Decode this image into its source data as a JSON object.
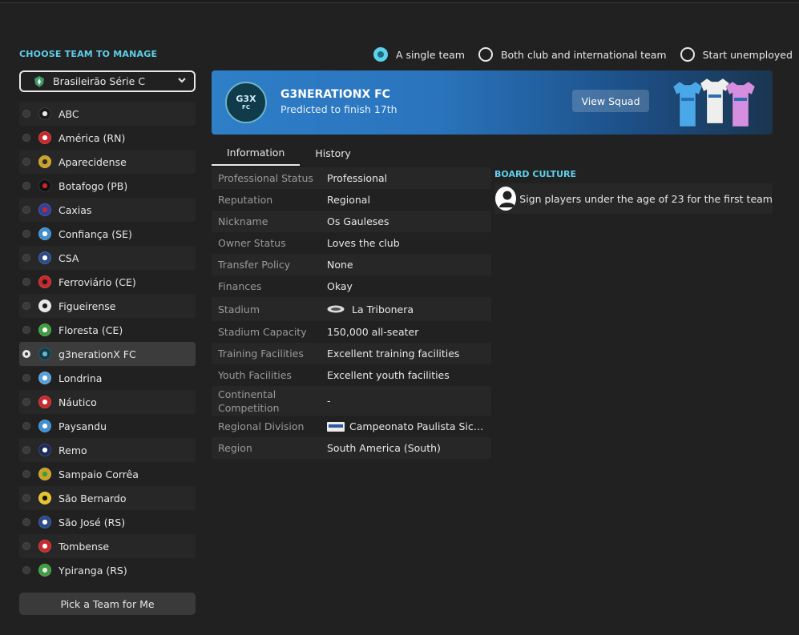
{
  "left": {
    "title": "CHOOSE TEAM TO MANAGE",
    "league": "Brasileirão Série C",
    "teams": [
      {
        "name": "ABC",
        "color": "#1b1b1b",
        "accent": "#e8e8e8"
      },
      {
        "name": "América (RN)",
        "color": "#c8282b",
        "accent": "#ffffff"
      },
      {
        "name": "Aparecidense",
        "color": "#c9a227",
        "accent": "#2b2b2b"
      },
      {
        "name": "Botafogo (PB)",
        "color": "#111111",
        "accent": "#c8282b"
      },
      {
        "name": "Caxias",
        "color": "#2f3f9b",
        "accent": "#c8282b"
      },
      {
        "name": "Confiança (SE)",
        "color": "#3f8fd0",
        "accent": "#ffffff"
      },
      {
        "name": "CSA",
        "color": "#2a4a8a",
        "accent": "#ffffff"
      },
      {
        "name": "Ferroviário (CE)",
        "color": "#c8282b",
        "accent": "#1b1b1b"
      },
      {
        "name": "Figueirense",
        "color": "#e8e8e8",
        "accent": "#1b1b1b"
      },
      {
        "name": "Floresta (CE)",
        "color": "#3f9b3f",
        "accent": "#ffffff"
      },
      {
        "name": "g3nerationX FC",
        "color": "#0f3b4a",
        "accent": "#6fb4c6",
        "selected": true
      },
      {
        "name": "Londrina",
        "color": "#5aa0d8",
        "accent": "#ffffff"
      },
      {
        "name": "Náutico",
        "color": "#c8282b",
        "accent": "#ffffff"
      },
      {
        "name": "Paysandu",
        "color": "#3f8fd0",
        "accent": "#ffffff"
      },
      {
        "name": "Remo",
        "color": "#1b2a5a",
        "accent": "#ffffff"
      },
      {
        "name": "Sampaio Corrêa",
        "color": "#c9a227",
        "accent": "#3f9b3f"
      },
      {
        "name": "São Bernardo",
        "color": "#e8c22a",
        "accent": "#111111"
      },
      {
        "name": "São José (RS)",
        "color": "#2a4a8a",
        "accent": "#ffffff"
      },
      {
        "name": "Tombense",
        "color": "#c8282b",
        "accent": "#ffffff"
      },
      {
        "name": "Ypiranga (RS)",
        "color": "#3f9b3f",
        "accent": "#e8e8e8"
      }
    ],
    "pick_button": "Pick a Team for Me"
  },
  "modes": [
    {
      "label": "A single team",
      "active": true
    },
    {
      "label": "Both club and international team",
      "active": false
    },
    {
      "label": "Start unemployed",
      "active": false
    }
  ],
  "club": {
    "name": "G3NERATIONX FC",
    "prediction": "Predicted to finish 17th",
    "crest_text": "G3X",
    "crest_sub": "FC",
    "view_squad": "View Squad",
    "kit_colors": [
      "#4aa8e8",
      "#eeeeee",
      "#d58ee0"
    ]
  },
  "tabs": [
    {
      "label": "Information",
      "active": true
    },
    {
      "label": "History",
      "active": false
    }
  ],
  "info": {
    "professional_status": {
      "label": "Professional Status",
      "value": "Professional"
    },
    "reputation": {
      "label": "Reputation",
      "value": "Regional"
    },
    "nickname": {
      "label": "Nickname",
      "value": "Os Gauleses"
    },
    "owner_status": {
      "label": "Owner Status",
      "value": "Loves the club"
    },
    "transfer_policy": {
      "label": "Transfer Policy",
      "value": "None"
    },
    "finances": {
      "label": "Finances",
      "value": "Okay"
    },
    "stadium": {
      "label": "Stadium",
      "value": "La Tribonera"
    },
    "stadium_capacity": {
      "label": "Stadium Capacity",
      "value": "150,000 all-seater"
    },
    "training_facilities": {
      "label": "Training Facilities",
      "value": "Excellent training facilities"
    },
    "youth_facilities": {
      "label": "Youth Facilities",
      "value": "Excellent youth facilities"
    },
    "continental_competition": {
      "label": "Continental Competition",
      "value": "-"
    },
    "regional_division": {
      "label": "Regional Division",
      "value": "Campeonato Paulista Sicredi"
    },
    "region": {
      "label": "Region",
      "value": "South America (South)"
    }
  },
  "board": {
    "title": "BOARD CULTURE",
    "item": "Sign players under the age of 23 for the first team"
  }
}
